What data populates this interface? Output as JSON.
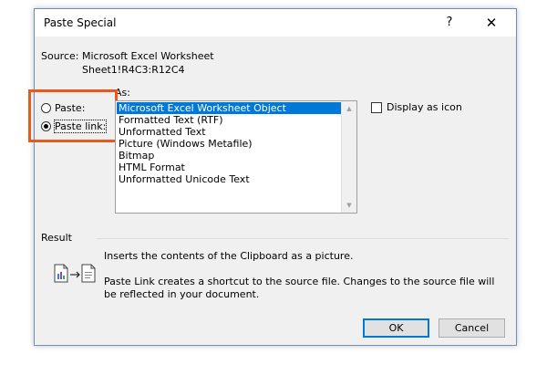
{
  "window": {
    "title": "Paste Special",
    "help_label": "?",
    "close_label": "✕"
  },
  "source": {
    "label": "Source:",
    "name": "Microsoft Excel Worksheet",
    "range": "Sheet1!R4C3:R12C4"
  },
  "as_label": "As:",
  "options": {
    "paste_label": "Paste:",
    "paste_checked": false,
    "paste_link_label": "Paste link:",
    "paste_link_checked": true
  },
  "formats": [
    "Microsoft Excel Worksheet Object",
    "Formatted Text (RTF)",
    "Unformatted Text",
    "Picture (Windows Metafile)",
    "Bitmap",
    "HTML Format",
    "Unformatted Unicode Text"
  ],
  "selected_format_index": 0,
  "display_as_icon": {
    "label": "Display as icon",
    "checked": false
  },
  "result": {
    "label": "Result",
    "line1": "Inserts the contents of the Clipboard as a picture.",
    "line2": "Paste Link creates a shortcut to the source file. Changes to the source file will be reflected in your document."
  },
  "buttons": {
    "ok": "OK",
    "cancel": "Cancel"
  },
  "colors": {
    "highlight_box": "#e65a1e",
    "selection": "#0078d7"
  }
}
